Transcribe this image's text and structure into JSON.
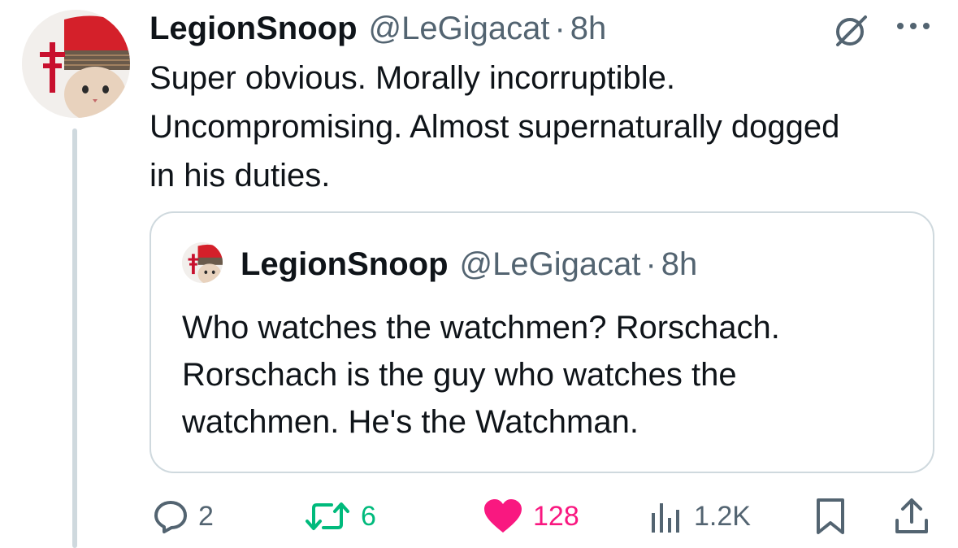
{
  "tweet": {
    "author_name": "LegionSnoop",
    "author_handle": "@LeGigacat",
    "separator": "·",
    "time": "8h",
    "text": "Super obvious. Morally incorruptible. Uncompromising. Almost supernaturally dogged in his duties."
  },
  "quote": {
    "author_name": "LegionSnoop",
    "author_handle": "@LeGigacat",
    "separator": "·",
    "time": "8h",
    "text": "Who watches the watchmen? Rorschach. Rorschach is the guy who watches the watchmen. He's the Watchman."
  },
  "actions": {
    "replies": "2",
    "reposts": "6",
    "likes": "128",
    "views": "1.2K"
  },
  "icons": {
    "reply": "reply-icon",
    "repost": "repost-icon",
    "like": "heart-icon",
    "views": "views-icon",
    "bookmark": "bookmark-icon",
    "share": "share-icon",
    "grok": "grok-icon",
    "more": "more-icon"
  },
  "colors": {
    "text": "#0f1419",
    "secondary": "#536471",
    "repost_green": "#00ba7c",
    "like_pink": "#f91880",
    "border": "#cfd9de"
  }
}
